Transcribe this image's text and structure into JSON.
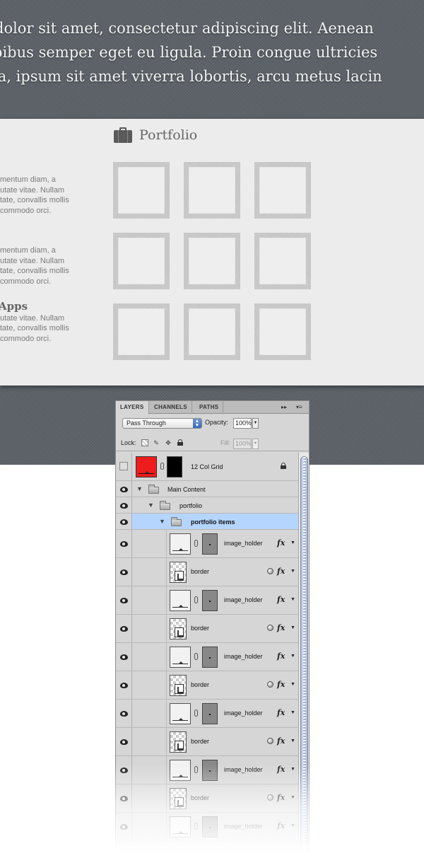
{
  "hero": {
    "lines": [
      "dolor sit amet, consectetur adipiscing elit. Aenean",
      "pibus semper eget eu ligula. Proin congue ultricies",
      "la, ipsum sit amet viverra lobortis, arcu metus lacin"
    ]
  },
  "portfolio": {
    "title": "Portfolio",
    "side_blocks": [
      {
        "title": "",
        "lines": [
          "mentum diam, a",
          "utate vitae. Nullam",
          "tate, convallis mollis",
          "commodo orci."
        ]
      },
      {
        "title": "",
        "lines": [
          "mentum diam, a",
          "utate vitae. Nullam",
          "tate, convallis mollis",
          "commodo orci."
        ]
      },
      {
        "title": "Apps",
        "lines": [
          "utate vitae. Nullam",
          "tate, convallis mollis",
          "commodo orci."
        ]
      }
    ]
  },
  "layers_panel": {
    "tabs": [
      "LAYERS",
      "CHANNELS",
      "PATHS"
    ],
    "panel_controls": {
      "collapse": "▸▸",
      "menu": "▾≡"
    },
    "blend_mode": "Pass Through",
    "opacity_label": "Opacity:",
    "opacity_value": "100%",
    "lock_label": "Lock:",
    "fill_label": "Fill:",
    "fill_value": "100%",
    "top_layer": {
      "name": "12 Col Grid"
    },
    "groups": {
      "main": "Main Content",
      "portfolio": "portfolio",
      "items": "portfolio items"
    },
    "layers": [
      {
        "name": "image_holder",
        "kind": "holder"
      },
      {
        "name": "border",
        "kind": "border"
      },
      {
        "name": "image_holder",
        "kind": "holder"
      },
      {
        "name": "border",
        "kind": "border"
      },
      {
        "name": "image_holder",
        "kind": "holder"
      },
      {
        "name": "border",
        "kind": "border"
      },
      {
        "name": "image_holder",
        "kind": "holder"
      },
      {
        "name": "border",
        "kind": "border"
      },
      {
        "name": "image_holder",
        "kind": "holder"
      },
      {
        "name": "border",
        "kind": "border"
      },
      {
        "name": "image_holder",
        "kind": "holder"
      }
    ],
    "fx_label": "fx",
    "colors": {
      "selected_row": "#b5d5ff",
      "grid_thumb": "#ee1c1c"
    }
  }
}
